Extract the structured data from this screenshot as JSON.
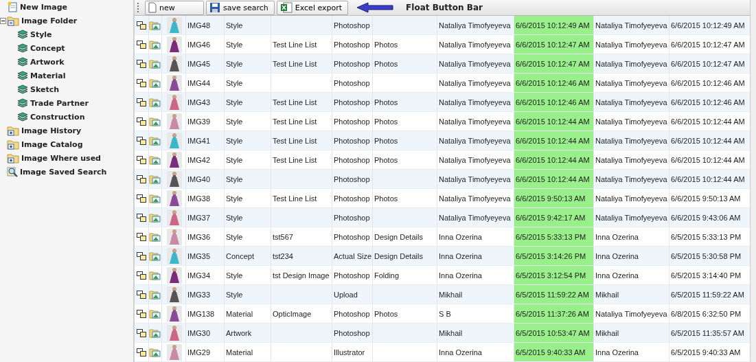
{
  "sidebar": {
    "items": [
      {
        "label": "New Image",
        "kind": "new"
      },
      {
        "label": "Image Folder",
        "kind": "folder",
        "expanded": true,
        "children": [
          {
            "label": "Style",
            "kind": "stack"
          },
          {
            "label": "Concept",
            "kind": "stack"
          },
          {
            "label": "Artwork",
            "kind": "stack"
          },
          {
            "label": "Material",
            "kind": "stack"
          },
          {
            "label": "Sketch",
            "kind": "stack"
          },
          {
            "label": "Trade Partner",
            "kind": "stack"
          },
          {
            "label": "Construction",
            "kind": "stack"
          }
        ]
      },
      {
        "label": "Image History",
        "kind": "folder",
        "expanded": false
      },
      {
        "label": "Image Catalog",
        "kind": "folder",
        "expanded": false
      },
      {
        "label": "Image Where used",
        "kind": "folder",
        "expanded": false
      },
      {
        "label": "Image Saved Search",
        "kind": "search"
      }
    ]
  },
  "toolbar": {
    "buttons": [
      {
        "label": "new",
        "kind": "new"
      },
      {
        "label": "save search",
        "kind": "save"
      },
      {
        "label": "Excel export",
        "kind": "excel"
      }
    ],
    "annotation": "Float Button Bar"
  },
  "table": {
    "columns": [
      {
        "highlighted": false
      },
      {
        "highlighted": false
      },
      {
        "highlighted": false
      },
      {
        "highlighted": false
      },
      {
        "highlighted": false
      },
      {
        "highlighted": false
      },
      {
        "highlighted": true
      },
      {
        "highlighted": false
      },
      {
        "highlighted": false
      }
    ],
    "rows": [
      {
        "column_1": "IMG48",
        "column_2": "Style",
        "column_4": "Photoshop",
        "column_6": "Nataliya Timofyeyeva",
        "column_7": "6/6/2015 10:12:49 AM",
        "column_8": "Nataliya Timofyeyeva",
        "column_9": "6/6/2015 10:12:49 AM"
      },
      {
        "column_1": "IMG46",
        "column_2": "Style",
        "column_3": "Test Line List",
        "column_4": "Photoshop",
        "column_5": "Photos",
        "column_6": "Nataliya Timofyeyeva",
        "column_7": "6/6/2015 10:12:47 AM",
        "column_8": "Nataliya Timofyeyeva",
        "column_9": "6/6/2015 10:12:47 AM"
      },
      {
        "column_1": "IMG45",
        "column_2": "Style",
        "column_3": "Test Line List",
        "column_4": "Photoshop",
        "column_5": "Photos",
        "column_6": "Nataliya Timofyeyeva",
        "column_7": "6/6/2015 10:12:47 AM",
        "column_8": "Nataliya Timofyeyeva",
        "column_9": "6/6/2015 10:12:47 AM"
      },
      {
        "column_1": "IMG44",
        "column_2": "Style",
        "column_4": "Photoshop",
        "column_6": "Nataliya Timofyeyeva",
        "column_7": "6/6/2015 10:12:46 AM",
        "column_8": "Nataliya Timofyeyeva",
        "column_9": "6/6/2015 10:12:46 AM"
      },
      {
        "column_1": "IMG43",
        "column_2": "Style",
        "column_3": "Test Line List",
        "column_4": "Photoshop",
        "column_5": "Photos",
        "column_6": "Nataliya Timofyeyeva",
        "column_7": "6/6/2015 10:12:46 AM",
        "column_8": "Nataliya Timofyeyeva",
        "column_9": "6/6/2015 10:12:46 AM"
      },
      {
        "column_1": "IMG39",
        "column_2": "Style",
        "column_3": "Test Line List",
        "column_4": "Photoshop",
        "column_5": "Photos",
        "column_6": "Nataliya Timofyeyeva",
        "column_7": "6/6/2015 10:12:44 AM",
        "column_8": "Nataliya Timofyeyeva",
        "column_9": "6/6/2015 10:12:44 AM"
      },
      {
        "column_1": "IMG41",
        "column_2": "Style",
        "column_3": "Test Line List",
        "column_4": "Photoshop",
        "column_5": "Photos",
        "column_6": "Nataliya Timofyeyeva",
        "column_7": "6/6/2015 10:12:44 AM",
        "column_8": "Nataliya Timofyeyeva",
        "column_9": "6/6/2015 10:12:44 AM"
      },
      {
        "column_1": "IMG42",
        "column_2": "Style",
        "column_3": "Test Line List",
        "column_4": "Photoshop",
        "column_5": "Photos",
        "column_6": "Nataliya Timofyeyeva",
        "column_7": "6/6/2015 10:12:44 AM",
        "column_8": "Nataliya Timofyeyeva",
        "column_9": "6/6/2015 10:12:44 AM"
      },
      {
        "column_1": "IMG40",
        "column_2": "Style",
        "column_4": "Photoshop",
        "column_6": "Nataliya Timofyeyeva",
        "column_7": "6/6/2015 10:12:44 AM",
        "column_8": "Nataliya Timofyeyeva",
        "column_9": "6/6/2015 10:12:44 AM"
      },
      {
        "column_1": "IMG38",
        "column_2": "Style",
        "column_3": "Test Line List",
        "column_4": "Photoshop",
        "column_5": "Photos",
        "column_6": "Nataliya Timofyeyeva",
        "column_7": "6/6/2015 9:50:13 AM",
        "column_8": "Nataliya Timofyeyeva",
        "column_9": "6/6/2015 9:50:13 AM"
      },
      {
        "column_1": "IMG37",
        "column_2": "Style",
        "column_4": "Photoshop",
        "column_6": "Nataliya Timofyeyeva",
        "column_7": "6/6/2015 9:42:17 AM",
        "column_8": "Nataliya Timofyeyeva",
        "column_9": "6/6/2015 9:43:06 AM"
      },
      {
        "column_1": "IMG36",
        "column_2": "Style",
        "column_3": "tst567",
        "column_4": "Photoshop",
        "column_5": "Design Details",
        "column_6": "Inna Ozerina",
        "column_7": "6/5/2015 5:33:13 PM",
        "column_8": "Inna Ozerina",
        "column_9": "6/5/2015 5:33:13 PM"
      },
      {
        "column_1": "IMG35",
        "column_2": "Concept",
        "column_3": "tst234",
        "column_4": "Actual Size",
        "column_5": "Design Details",
        "column_6": "Inna Ozerina",
        "column_7": "6/5/2015 3:14:26 PM",
        "column_8": "Inna Ozerina",
        "column_9": "6/5/2015 5:30:58 PM"
      },
      {
        "column_1": "IMG34",
        "column_2": "Style",
        "column_3": "tst Design Image",
        "column_4": "Photoshop",
        "column_5": "Folding",
        "column_6": "Inna Ozerina",
        "column_7": "6/5/2015 3:12:54 PM",
        "column_8": "Inna Ozerina",
        "column_9": "6/5/2015 3:14:40 PM"
      },
      {
        "column_1": "IMG33",
        "column_2": "Style",
        "column_4": "Upload",
        "column_6": "Mikhail",
        "column_7": "6/5/2015 11:59:22 AM",
        "column_8": "Mikhail",
        "column_9": "6/5/2015 11:59:22 AM"
      },
      {
        "column_1": "IMG138",
        "column_2": "Material",
        "column_3": "OpticImage",
        "column_4": "Photoshop",
        "column_5": "Photos",
        "column_6": "S B",
        "column_7": "6/5/2015 11:37:26 AM",
        "column_8": "Nataliya Timofyeyeva",
        "column_9": "6/8/2015 6:32:50 PM"
      },
      {
        "column_1": "IMG30",
        "column_2": "Artwork",
        "column_4": "Photoshop",
        "column_6": "Mikhail",
        "column_7": "6/5/2015 10:53:47 AM",
        "column_8": "Mikhail",
        "column_9": "6/5/2015 11:35:57 AM"
      },
      {
        "column_1": "IMG29",
        "column_2": "Material",
        "column_4": "Illustrator",
        "column_6": "Inna Ozerina",
        "column_7": "6/5/2015 9:40:33 AM",
        "column_8": "Inna Ozerina",
        "column_9": "6/5/2015 9:40:33 AM"
      }
    ]
  }
}
